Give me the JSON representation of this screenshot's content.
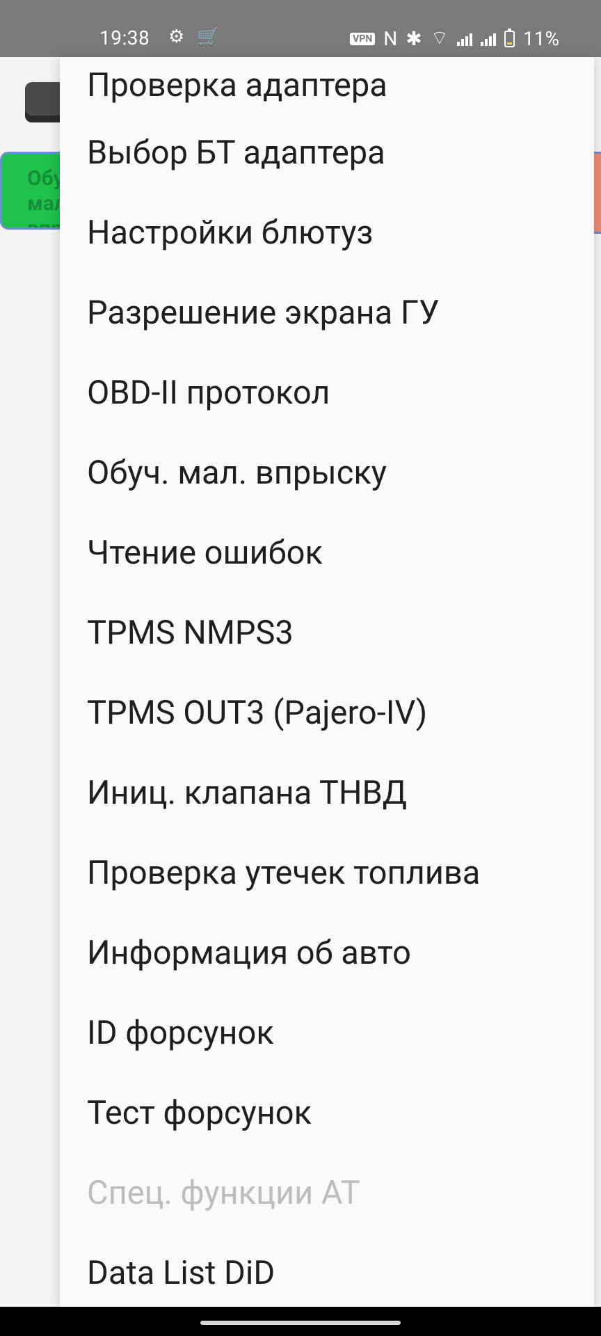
{
  "status_bar": {
    "time": "19:38",
    "vpn": "VPN",
    "battery": "11%"
  },
  "background": {
    "green_button": "Обуч. мал. впрыску"
  },
  "menu": {
    "items": [
      {
        "label": "Проверка адаптера",
        "enabled": true
      },
      {
        "label": "Выбор БТ адаптера",
        "enabled": true
      },
      {
        "label": "Настройки блютуз",
        "enabled": true
      },
      {
        "label": "Разрешение экрана ГУ",
        "enabled": true
      },
      {
        "label": "OBD-II протокол",
        "enabled": true
      },
      {
        "label": "Обуч. мал. впрыску",
        "enabled": true
      },
      {
        "label": "Чтение ошибок",
        "enabled": true
      },
      {
        "label": "TPMS NMPS3",
        "enabled": true
      },
      {
        "label": "TPMS OUT3 (Pajero-IV)",
        "enabled": true
      },
      {
        "label": "Иниц. клапана ТНВД",
        "enabled": true
      },
      {
        "label": "Проверка утечек топлива",
        "enabled": true
      },
      {
        "label": "Информация об авто",
        "enabled": true
      },
      {
        "label": "ID форсунок",
        "enabled": true
      },
      {
        "label": "Тест форсунок",
        "enabled": true
      },
      {
        "label": "Спец. функции АТ",
        "enabled": false
      },
      {
        "label": "Data List DiD",
        "enabled": true
      }
    ]
  }
}
